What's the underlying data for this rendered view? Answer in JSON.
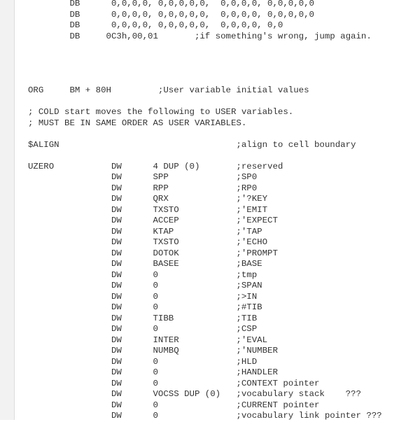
{
  "editor": {
    "lines": [
      "        DB      0,0,0,0, 0,0,0,0,0,  0,0,0,0, 0,0,0,0,0",
      "        DB      0,0,0,0, 0,0,0,0,0,  0,0,0,0, 0,0,0,0,0",
      "        DB      0,0,0,0, 0,0,0,0,0,  0,0,0,0, 0,0",
      "        DB     0C3h,00,01       ;if something's wrong, jump again.",
      "",
      "",
      "",
      "",
      "ORG     BM + 80H         ;User variable initial values",
      "",
      "; COLD start moves the following to USER variables.",
      "; MUST BE IN SAME ORDER AS USER VARIABLES.",
      "",
      "$ALIGN                                  ;align to cell boundary",
      "",
      "UZERO           DW      4 DUP (0)       ;reserved",
      "                DW      SPP             ;SP0",
      "                DW      RPP             ;RP0",
      "                DW      QRX             ;'?KEY",
      "                DW      TXSTO           ;'EMIT",
      "                DW      ACCEP           ;'EXPECT",
      "                DW      KTAP            ;'TAP",
      "                DW      TXSTO           ;'ECHO",
      "                DW      DOTOK           ;'PROMPT",
      "                DW      BASEE           ;BASE",
      "                DW      0               ;tmp",
      "                DW      0               ;SPAN",
      "                DW      0               ;>IN",
      "                DW      0               ;#TIB",
      "                DW      TIBB            ;TIB",
      "                DW      0               ;CSP",
      "                DW      INTER           ;'EVAL",
      "                DW      NUMBQ           ;'NUMBER",
      "                DW      0               ;HLD",
      "                DW      0               ;HANDLER",
      "                DW      0               ;CONTEXT pointer",
      "                DW      VOCSS DUP (0)   ;vocabulary stack    ???",
      "                DW      0               ;CURRENT pointer",
      "                DW      0               ;vocabulary link pointer ???"
    ]
  }
}
